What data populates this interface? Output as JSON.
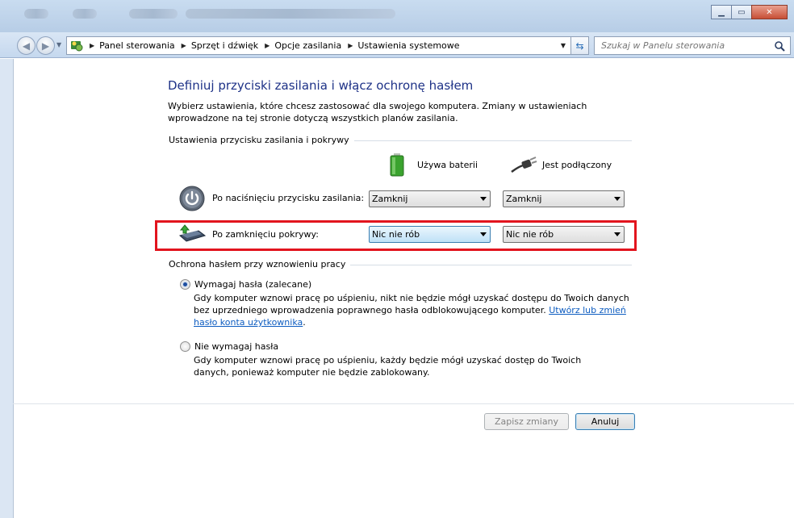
{
  "nav": {
    "breadcrumbs": [
      "Panel sterowania",
      "Sprzęt i dźwięk",
      "Opcje zasilania",
      "Ustawienia systemowe"
    ],
    "search_placeholder": "Szukaj w Panelu sterowania"
  },
  "page": {
    "title": "Definiuj przyciski zasilania i włącz ochronę hasłem",
    "intro": "Wybierz ustawienia, które chcesz zastosować dla swojego komputera. Zmiany w ustawieniach wprowadzone na tej stronie dotyczą wszystkich planów zasilania."
  },
  "power_group": {
    "title": "Ustawienia przycisku zasilania i pokrywy",
    "col_battery": "Używa baterii",
    "col_plugged": "Jest podłączony",
    "rows": [
      {
        "label": "Po naciśnięciu przycisku zasilania:",
        "battery": "Zamknij",
        "plugged": "Zamknij"
      },
      {
        "label": "Po zamknięciu pokrywy:",
        "battery": "Nic nie rób",
        "plugged": "Nic nie rób"
      }
    ]
  },
  "password_group": {
    "title": "Ochrona hasłem przy wznowieniu pracy",
    "option_require": {
      "label": "Wymagaj hasła (zalecane)",
      "desc1": "Gdy komputer wznowi pracę po uśpieniu, nikt nie będzie mógł uzyskać dostępu do Twoich danych",
      "desc2": "bez uprzedniego wprowadzenia poprawnego hasła odblokowującego komputer.",
      "link": "Utwórz lub zmień hasło konta użytkownika",
      "selected": true
    },
    "option_norequire": {
      "label": "Nie wymagaj hasła",
      "desc": "Gdy komputer wznowi pracę po uśpieniu, każdy będzie mógł uzyskać dostęp do Twoich danych, ponieważ komputer nie będzie zablokowany.",
      "selected": false
    }
  },
  "buttons": {
    "save": "Zapisz zmiany",
    "cancel": "Anuluj"
  },
  "colors": {
    "title": "#1e3287",
    "highlight": "#e2141e",
    "link": "#0d5cc0"
  }
}
